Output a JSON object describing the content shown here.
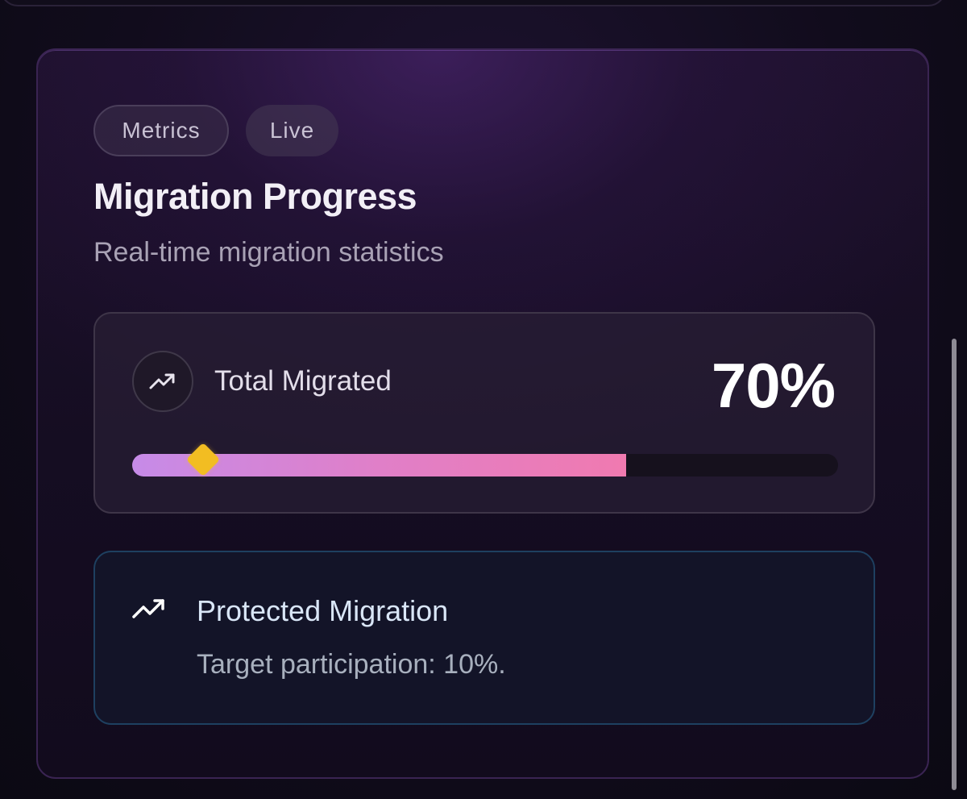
{
  "tags": {
    "metrics": "Metrics",
    "live": "Live"
  },
  "header": {
    "title": "Migration Progress",
    "subtitle": "Real-time migration statistics"
  },
  "total": {
    "icon": "trending-up-icon",
    "label": "Total Migrated",
    "value_text": "70%",
    "progress_fraction": 0.7,
    "target_marker_fraction": 0.1
  },
  "protected": {
    "icon": "trending-up-icon",
    "title": "Protected Migration",
    "text": "Target participation: 10%."
  },
  "colors": {
    "progress_start": "#c68be8",
    "progress_end": "#f07ab0",
    "marker": "#f2bd22",
    "info_border": "#1e4060"
  }
}
